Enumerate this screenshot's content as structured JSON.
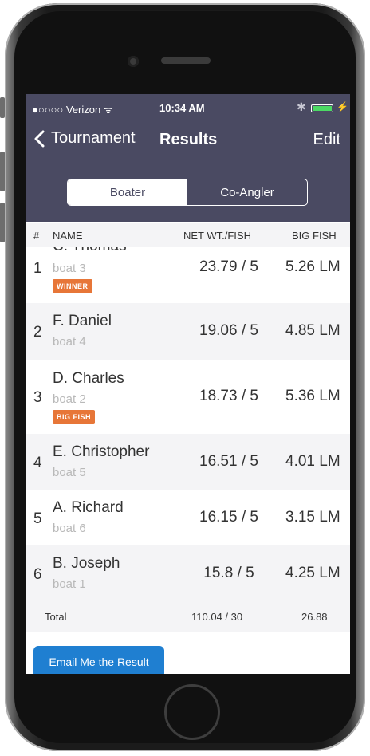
{
  "status": {
    "carrier": "●○○○○ Verizon ᯤ",
    "time": "10:34 AM",
    "bt": "✱",
    "charge": "⚡"
  },
  "nav": {
    "back_label": "Tournament",
    "title": "Results",
    "edit_label": "Edit"
  },
  "segment": {
    "boater": "Boater",
    "coangler": "Co-Angler"
  },
  "table": {
    "headers": {
      "rank": "#",
      "name": "NAME",
      "net": "NET WT./FISH",
      "big": "BIG FISH"
    },
    "rows": [
      {
        "rank": "1",
        "name": "C. Thomas",
        "boat": "boat 3",
        "badge": "WINNER",
        "net": "23.79 / 5",
        "big": "5.26 LM"
      },
      {
        "rank": "2",
        "name": "F. Daniel",
        "boat": "boat 4",
        "net": "19.06 / 5",
        "big": "4.85 LM"
      },
      {
        "rank": "3",
        "name": "D. Charles",
        "boat": "boat 2",
        "badge": "BIG FISH",
        "net": "18.73 / 5",
        "big": "5.36 LM"
      },
      {
        "rank": "4",
        "name": "E. Christopher",
        "boat": "boat 5",
        "net": "16.51 / 5",
        "big": "4.01 LM"
      },
      {
        "rank": "5",
        "name": "A. Richard",
        "boat": "boat 6",
        "net": "16.15 / 5",
        "big": "3.15 LM"
      },
      {
        "rank": "6",
        "name": "B. Joseph",
        "boat": "boat 1",
        "net": "15.8 / 5",
        "big": "4.25 LM"
      }
    ],
    "total": {
      "label": "Total",
      "net": "110.04 / 30",
      "big": "26.88"
    }
  },
  "email_button": "Email Me the Result",
  "colors": {
    "nav_bg": "#4a4a62",
    "badge": "#e77638",
    "button": "#1f7fd1",
    "stripe": "#f4f4f6"
  }
}
